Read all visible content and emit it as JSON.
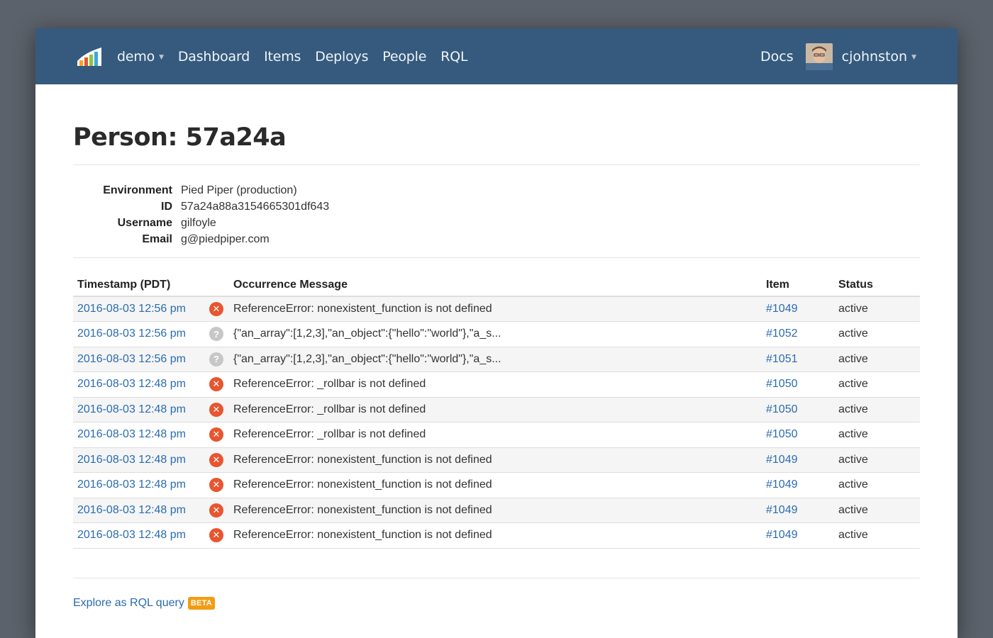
{
  "nav": {
    "project": "demo",
    "links": [
      "Dashboard",
      "Items",
      "Deploys",
      "People",
      "RQL"
    ],
    "docs": "Docs",
    "user": "cjohnston"
  },
  "page": {
    "title": "Person: 57a24a"
  },
  "details": [
    {
      "key": "Environment",
      "value": "Pied Piper (production)"
    },
    {
      "key": "ID",
      "value": "57a24a88a3154665301df643"
    },
    {
      "key": "Username",
      "value": "gilfoyle"
    },
    {
      "key": "Email",
      "value": "g@piedpiper.com"
    }
  ],
  "table": {
    "headers": {
      "timestamp": "Timestamp (PDT)",
      "message": "Occurrence Message",
      "item": "Item",
      "status": "Status"
    },
    "rows": [
      {
        "timestamp": "2016-08-03 12:56 pm",
        "level": "error",
        "message": "ReferenceError: nonexistent_function is not defined",
        "item": "#1049",
        "status": "active"
      },
      {
        "timestamp": "2016-08-03 12:56 pm",
        "level": "unknown",
        "message": "{\"an_array\":[1,2,3],\"an_object\":{\"hello\":\"world\"},\"a_s...",
        "item": "#1052",
        "status": "active"
      },
      {
        "timestamp": "2016-08-03 12:56 pm",
        "level": "unknown",
        "message": "{\"an_array\":[1,2,3],\"an_object\":{\"hello\":\"world\"},\"a_s...",
        "item": "#1051",
        "status": "active"
      },
      {
        "timestamp": "2016-08-03 12:48 pm",
        "level": "error",
        "message": "ReferenceError: _rollbar is not defined",
        "item": "#1050",
        "status": "active"
      },
      {
        "timestamp": "2016-08-03 12:48 pm",
        "level": "error",
        "message": "ReferenceError: _rollbar is not defined",
        "item": "#1050",
        "status": "active"
      },
      {
        "timestamp": "2016-08-03 12:48 pm",
        "level": "error",
        "message": "ReferenceError: _rollbar is not defined",
        "item": "#1050",
        "status": "active"
      },
      {
        "timestamp": "2016-08-03 12:48 pm",
        "level": "error",
        "message": "ReferenceError: nonexistent_function is not defined",
        "item": "#1049",
        "status": "active"
      },
      {
        "timestamp": "2016-08-03 12:48 pm",
        "level": "error",
        "message": "ReferenceError: nonexistent_function is not defined",
        "item": "#1049",
        "status": "active"
      },
      {
        "timestamp": "2016-08-03 12:48 pm",
        "level": "error",
        "message": "ReferenceError: nonexistent_function is not defined",
        "item": "#1049",
        "status": "active"
      },
      {
        "timestamp": "2016-08-03 12:48 pm",
        "level": "error",
        "message": "ReferenceError: nonexistent_function is not defined",
        "item": "#1049",
        "status": "active"
      }
    ]
  },
  "footer": {
    "explore_label": "Explore as RQL query",
    "beta_label": "BETA"
  },
  "colors": {
    "navbar": "#355a7e",
    "link": "#2a6cb0",
    "error_icon": "#e8552f",
    "unknown_icon": "#c7c7c7",
    "beta_badge": "#f39c12"
  },
  "icons": {
    "error": "close-x",
    "unknown": "question-mark"
  }
}
